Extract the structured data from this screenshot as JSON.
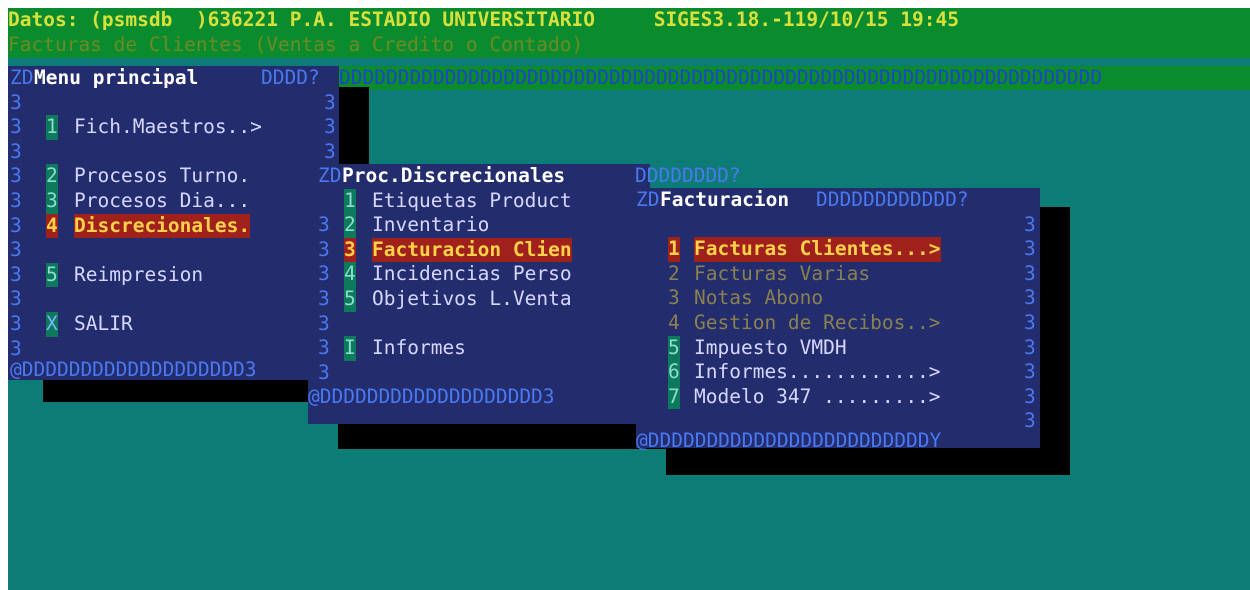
{
  "header": {
    "status_line": "Datos: (psmsdb  )636221 P.A. ESTADIO UNIVERSITARIO     SIGES3.18.-119/10/15 19:45",
    "module_line": "Facturas de Clientes (Ventas a Credito o Contado)"
  },
  "frame_fill": "DDDDDDDDDDDDDDDDDDDDDDDDDDDDDDDDDDDDDDDDDDDDDDDDDDDDDDDDDDDDDDDDD",
  "menu_principal": {
    "title": "Menu principal",
    "top_left": "ZD",
    "top_right": "DDDD?",
    "bottom": "@DDDDDDDDDDDDDDDDDDD3",
    "border_char": "3",
    "items": [
      {
        "key": "1",
        "label": "Fich.Maestros..>"
      },
      {
        "key": "2",
        "label": "Procesos Turno."
      },
      {
        "key": "3",
        "label": "Procesos Dia..."
      },
      {
        "key": "4",
        "label": "Discrecionales."
      },
      {
        "key": "5",
        "label": "Reimpresion"
      },
      {
        "key": "X",
        "label": "SALIR"
      }
    ]
  },
  "proc_discrecionales": {
    "title": "Proc.Discrecionales",
    "top_left": "ZD",
    "top_right": "DDDDDDDD?",
    "bottom": "@DDDDDDDDDDDDDDDDDDD3",
    "border_char": "3",
    "items": [
      {
        "key": "1",
        "label": "Etiquetas Product"
      },
      {
        "key": "2",
        "label": "Inventario"
      },
      {
        "key": "3",
        "label": "Facturacion Clien"
      },
      {
        "key": "4",
        "label": "Incidencias Perso"
      },
      {
        "key": "5",
        "label": "Objetivos L.Venta"
      },
      {
        "key": "I",
        "label": "Informes"
      }
    ]
  },
  "facturacion": {
    "title": "Facturacion",
    "top_left": "ZD",
    "top_right": "DDDDDDDDDDDD?",
    "bottom": "@DDDDDDDDDDDDDDDDDDDDDDDDY",
    "border_char": "3",
    "items": [
      {
        "key": "1",
        "label": "Facturas Clientes...>"
      },
      {
        "key": "2",
        "label": "Facturas Varias"
      },
      {
        "key": "3",
        "label": "Notas Abono"
      },
      {
        "key": "4",
        "label": "Gestion de Recibos..>"
      },
      {
        "key": "5",
        "label": "Impuesto VMDH"
      },
      {
        "key": "6",
        "label": "Informes............>"
      },
      {
        "key": "7",
        "label": "Modelo 347 .........>"
      }
    ]
  },
  "colors": {
    "background": "#0e7c76",
    "header_band": "#0a8c2e",
    "window": "#232d6e",
    "selected": "#a0201c"
  }
}
